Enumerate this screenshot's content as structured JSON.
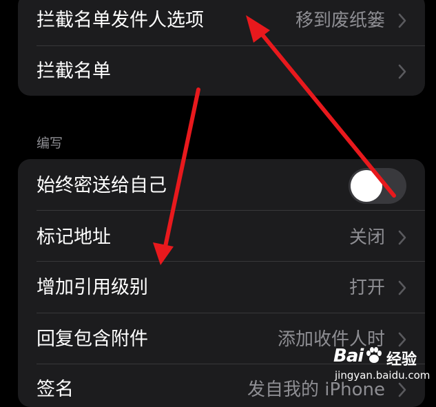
{
  "group1": {
    "rows": [
      {
        "label": "拦截名单发件人选项",
        "value": "移到废纸篓"
      },
      {
        "label": "拦截名单",
        "value": ""
      }
    ]
  },
  "section_compose": {
    "header": "编写"
  },
  "group2": {
    "toggle_row": {
      "label": "始终密送给自己",
      "state": "off"
    },
    "rows": [
      {
        "label": "标记地址",
        "value": "关闭"
      },
      {
        "label": "增加引用级别",
        "value": "打开"
      },
      {
        "label": "回复包含附件",
        "value": "添加收件人时"
      },
      {
        "label": "签名",
        "value": "发自我的 iPhone"
      }
    ]
  },
  "watermark": {
    "brand": "Bai",
    "suffix": "经验",
    "url": "jingyan.baidu.com"
  },
  "colors": {
    "background": "#000000",
    "cell": "#1c1c1e",
    "separator": "#38383a",
    "secondary_text": "#8e8e93",
    "toggle_off": "#39393d",
    "annotation_arrow": "#e8191d"
  }
}
